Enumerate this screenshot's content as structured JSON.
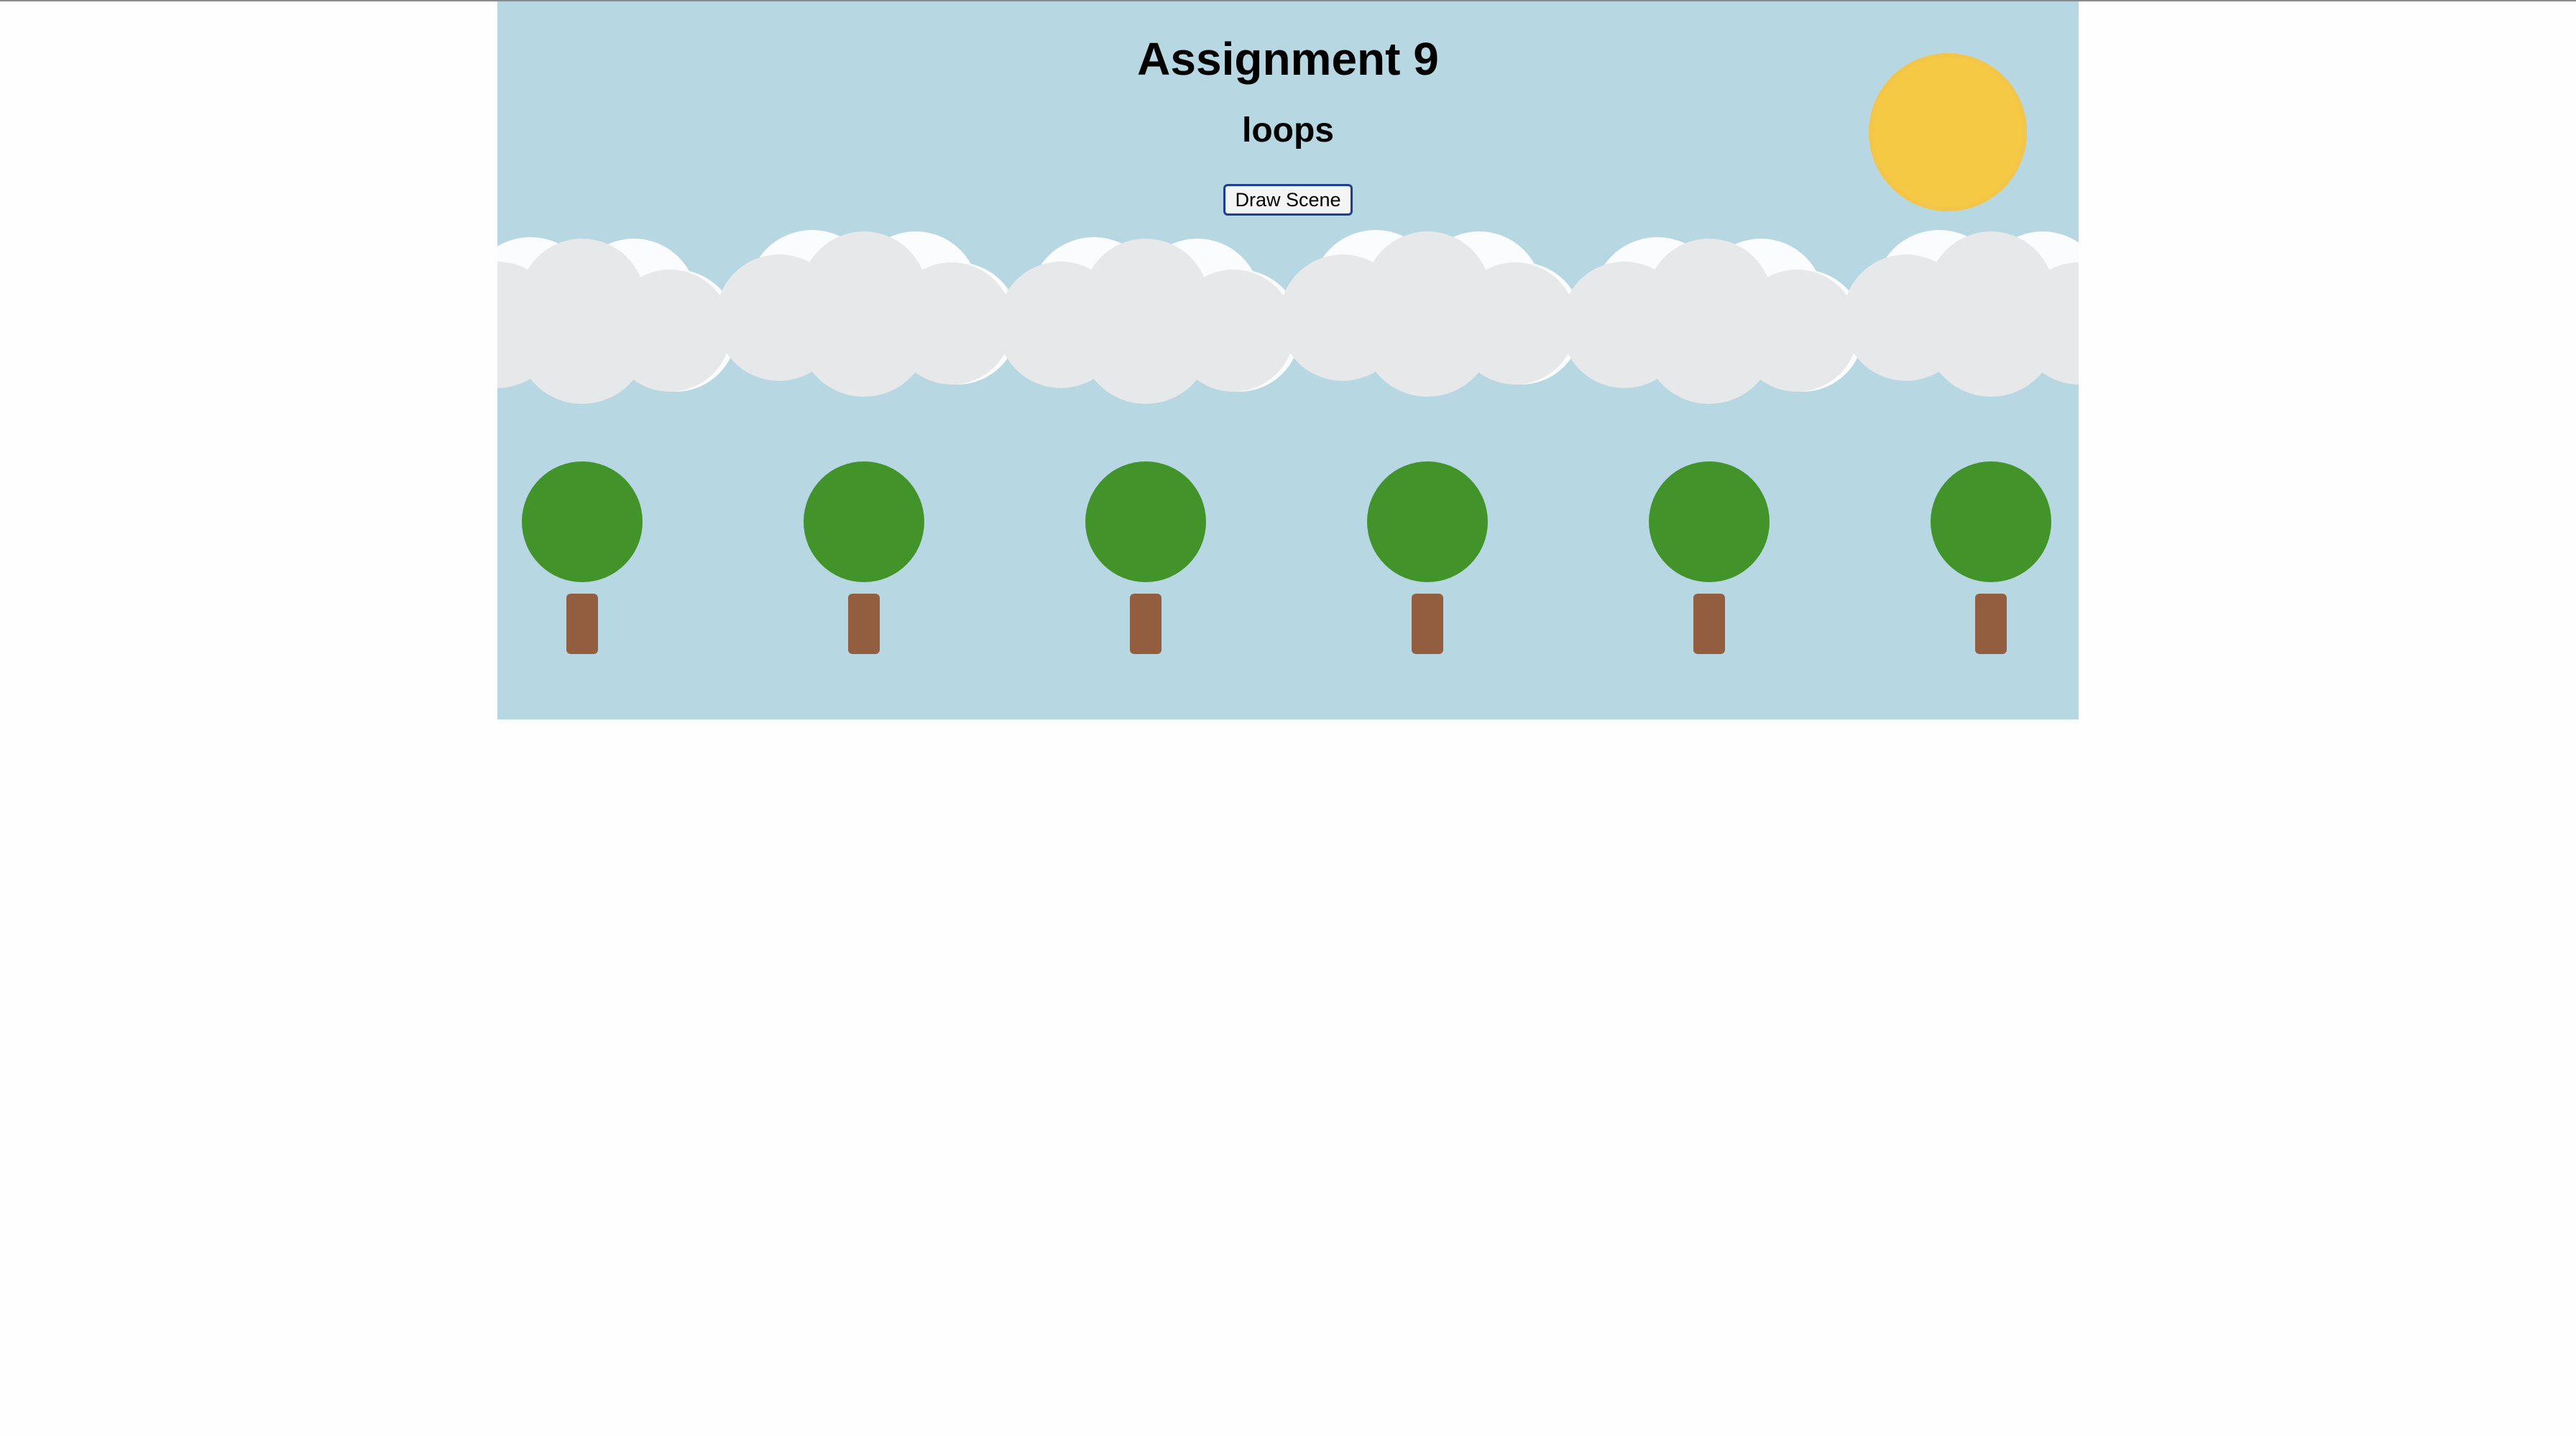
{
  "page": {
    "title": "Assignment 9",
    "subtitle": "loops",
    "button_label": "Draw Scene"
  },
  "colors": {
    "sky": "#b7d7e2",
    "sun": "#f6c945",
    "cloud_white": "#fbfcfd",
    "cloud_grey": "#e7e8ea",
    "leaves": "#43932b",
    "trunk": "#935d40"
  },
  "scene": {
    "tree_count": 6,
    "cloud_count": 6
  }
}
